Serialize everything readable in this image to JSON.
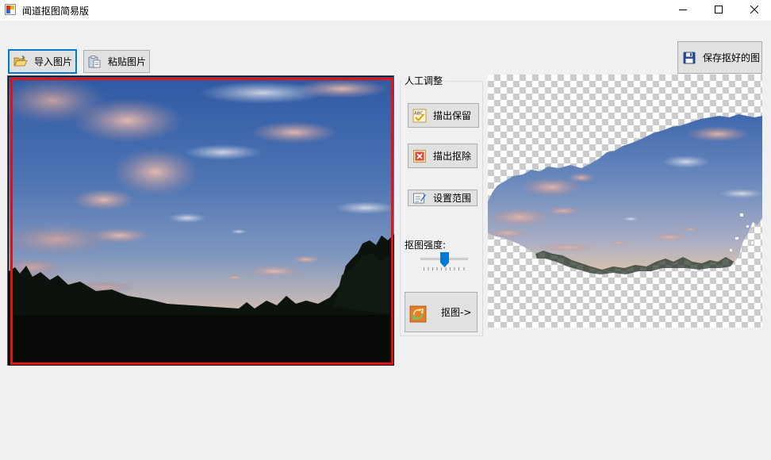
{
  "window": {
    "title": "闻道抠图简易版",
    "controls": [
      "minimize",
      "maximize",
      "close"
    ]
  },
  "toolbar": {
    "import_label": "导入图片",
    "paste_label": "粘贴图片",
    "save_label": "保存抠好的图"
  },
  "adjust_group": {
    "title": "人工调整",
    "keep_label": "描出保留",
    "remove_label": "描出抠除",
    "range_label": "设置范围",
    "strength_label": "抠图强度:",
    "strength_value": 0.5,
    "cut_label": "抠图->"
  },
  "icons": {
    "app": "app-icon",
    "import": "open-folder-icon",
    "paste": "paste-icon",
    "save": "floppy-disk-icon",
    "keep": "spellcheck-icon",
    "remove": "delete-x-icon",
    "range": "edit-form-icon",
    "cut": "convert-icon"
  },
  "colors": {
    "selection_outline": "#e11414",
    "focus_border": "#0078d7",
    "slider_thumb": "#0078d7"
  }
}
